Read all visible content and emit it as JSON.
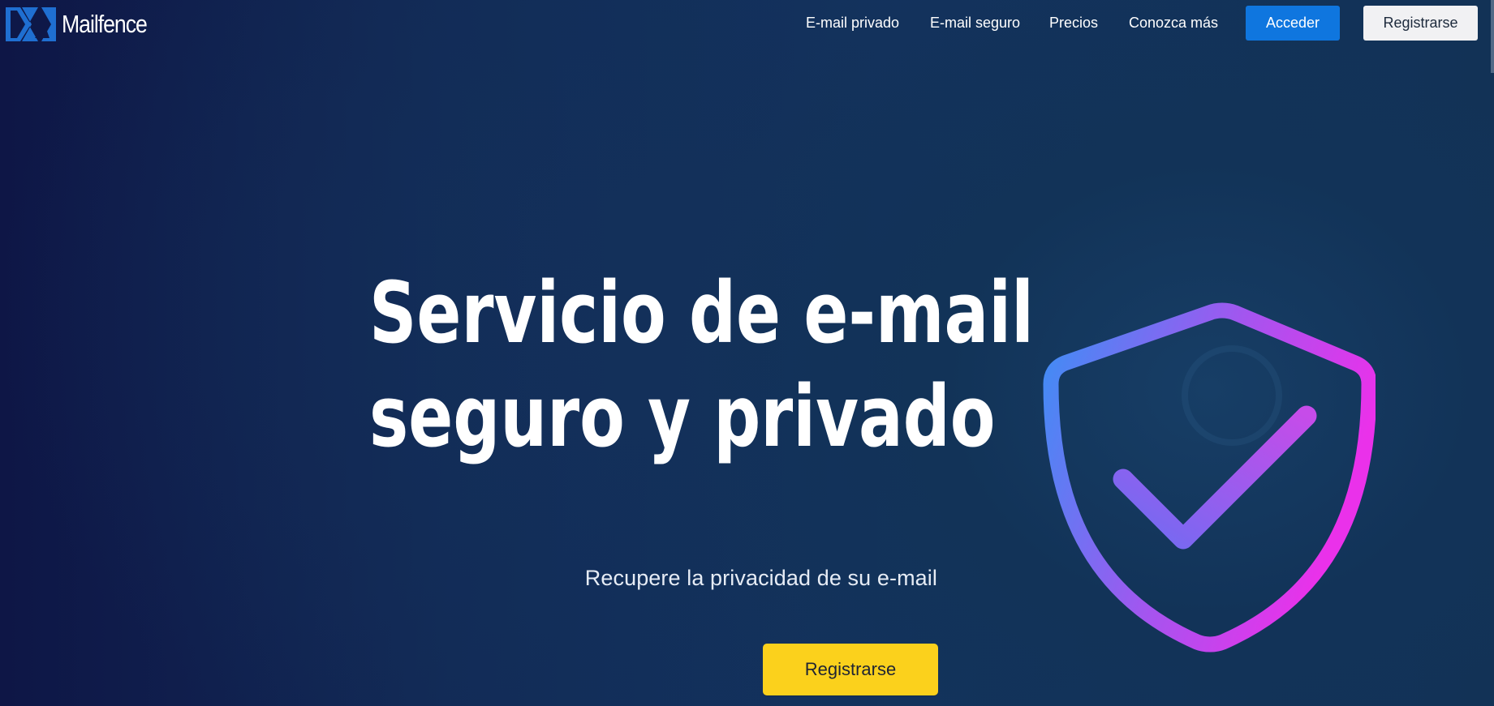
{
  "brand": {
    "name": "Mailfence",
    "logo_icon": "mailfence-logo-icon",
    "colors": {
      "logo_blue": "#1f6fd1",
      "accent_blue": "#0f76df",
      "cta_yellow": "#fbd11c",
      "shield_gradient_start": "#3e8ef5",
      "shield_gradient_end": "#ea31ea"
    }
  },
  "nav": {
    "links": [
      {
        "label": "E-mail privado"
      },
      {
        "label": "E-mail seguro"
      },
      {
        "label": "Precios"
      },
      {
        "label": "Conozca más"
      }
    ],
    "login_label": "Acceder",
    "register_label": "Registrarse"
  },
  "hero": {
    "title_line1": "Servicio de e-mail",
    "title_line2": "seguro y privado",
    "subtitle": "Recupere la privacidad de su e-mail",
    "cta_label": "Registrarse",
    "illustration_icon": "shield-check-icon"
  }
}
